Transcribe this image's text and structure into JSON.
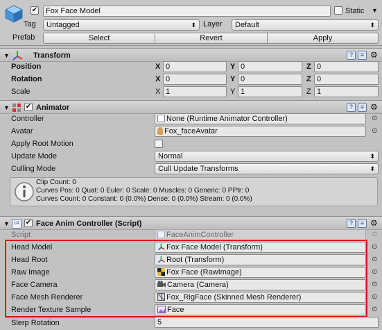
{
  "gameobject": {
    "name": "Fox Face Model",
    "static_label": "Static",
    "static_checked": false,
    "active_checked": true,
    "tag_label": "Tag",
    "tag_value": "Untagged",
    "layer_label": "Layer",
    "layer_value": "Default",
    "prefab_label": "Prefab",
    "prefab_buttons": [
      "Select",
      "Revert",
      "Apply"
    ]
  },
  "transform": {
    "title": "Transform",
    "rows": [
      {
        "label": "Position",
        "x": "0",
        "y": "0",
        "z": "0"
      },
      {
        "label": "Rotation",
        "x": "0",
        "y": "0",
        "z": "0"
      },
      {
        "label": "Scale",
        "x": "1",
        "y": "1",
        "z": "1"
      }
    ],
    "axis": {
      "x": "X",
      "y": "Y",
      "z": "Z"
    }
  },
  "animator": {
    "title": "Animator",
    "enabled": true,
    "controller_label": "Controller",
    "controller_value": "None (Runtime Animator Controller)",
    "avatar_label": "Avatar",
    "avatar_value": "Fox_faceAvatar",
    "apply_root_motion_label": "Apply Root Motion",
    "apply_root_motion_checked": false,
    "update_mode_label": "Update Mode",
    "update_mode_value": "Normal",
    "culling_mode_label": "Culling Mode",
    "culling_mode_value": "Cull Update Transforms",
    "info_lines": [
      "Clip Count: 0",
      "Curves Pos: 0 Quat: 0 Euler: 0 Scale: 0 Muscles: 0 Generic: 0 PPtr: 0",
      "Curves Count: 0 Constant: 0 (0.0%) Dense: 0 (0.0%) Stream: 0 (0.0%)"
    ]
  },
  "face_anim": {
    "title": "Face Anim Controller (Script)",
    "enabled": true,
    "script_label": "Script",
    "script_value": "FaceAnimController",
    "fields": [
      {
        "label": "Head Model",
        "value": "Fox Face Model (Transform)",
        "icon": "transform-icon"
      },
      {
        "label": "Head Root",
        "value": "Root (Transform)",
        "icon": "transform-icon"
      },
      {
        "label": "Raw Image",
        "value": "Fox Face (RawImage)",
        "icon": "rawimage-icon"
      },
      {
        "label": "Face Camera",
        "value": "Camera (Camera)",
        "icon": "camera-icon"
      },
      {
        "label": "Face Mesh Renderer",
        "value": "Fox_RigFace (Skinned Mesh Renderer)",
        "icon": "mesh-renderer-icon"
      },
      {
        "label": "Render Texture Sample",
        "value": "Face",
        "icon": "render-texture-icon"
      }
    ],
    "slerp_label": "Slerp Rotation",
    "slerp_value": "5"
  },
  "colors": {
    "highlight": "#e01010",
    "panel_bg": "#c2c2c2"
  }
}
